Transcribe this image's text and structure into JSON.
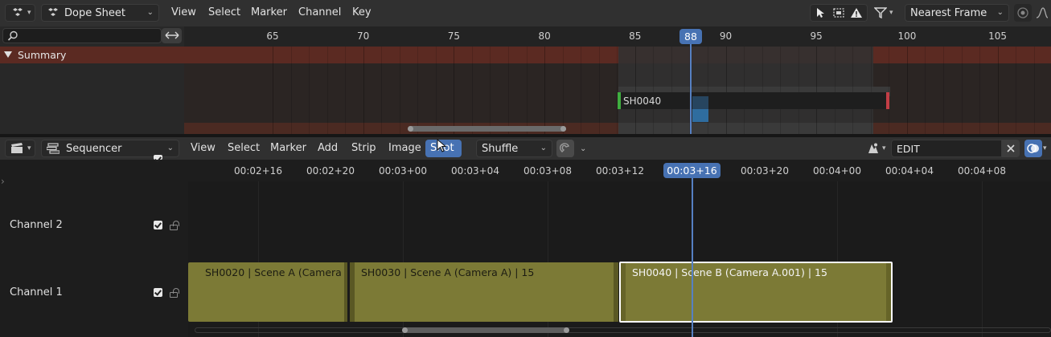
{
  "dopesheet": {
    "editor_type_icon": "dopesheet-editor-icon",
    "mode_label": "Dope Sheet",
    "menus": [
      "View",
      "Select",
      "Marker",
      "Channel",
      "Key"
    ],
    "snap_label": "Nearest Frame",
    "search": {
      "value": "",
      "placeholder": ""
    },
    "summary_label": "Summary",
    "ruler": [
      "65",
      "70",
      "75",
      "80",
      "85",
      "90",
      "95",
      "100",
      "105"
    ],
    "current_frame": "88",
    "shot_label": "SH0040",
    "colors": {
      "summary_row": "#5b2a22",
      "accent": "#4772b3",
      "playhead": "#5680c2"
    }
  },
  "sequencer": {
    "editor_type_icon": "clapperboard-icon",
    "mode_label": "Sequencer",
    "menus": [
      "View",
      "Select",
      "Marker",
      "Add",
      "Strip",
      "Image",
      "Shot"
    ],
    "active_menu": "Shot",
    "overlap_mode": "Shuffle",
    "scene_field": {
      "value": "EDIT",
      "placeholder": ""
    },
    "ruler": [
      "00:02+16",
      "00:02+20",
      "00:03+00",
      "00:03+04",
      "00:03+08",
      "00:03+12",
      "00:03+16",
      "00:03+20",
      "00:04+00",
      "00:04+04",
      "00:04+08"
    ],
    "current_time": "00:03+16",
    "channels": [
      {
        "label": "Channel 2"
      },
      {
        "label": "Channel 1"
      }
    ],
    "strips": [
      {
        "label": "SH0020 | Scene A (Camera",
        "selected": false
      },
      {
        "label": "SH0030 | Scene A (Camera A) | 15",
        "selected": false
      },
      {
        "label": "SH0040 | Scene B (Camera A.001) | 15",
        "selected": true
      }
    ],
    "colors": {
      "strip": "#7c7a36",
      "strip_selected_border": "#ffffff"
    }
  }
}
